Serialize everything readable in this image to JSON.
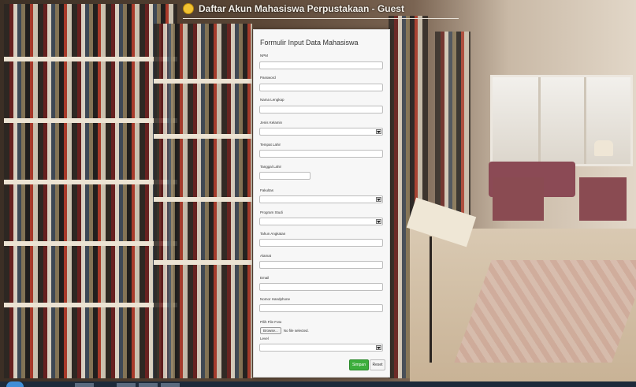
{
  "page": {
    "title": "Daftar Akun Mahasiswa Perpustakaan - Guest"
  },
  "form": {
    "title": "Formulir Input Data Mahasiswa",
    "fields": [
      {
        "label": "NPM",
        "type": "text",
        "value": ""
      },
      {
        "label": "Password",
        "type": "text",
        "value": ""
      },
      {
        "label": "Nama Lengkap",
        "type": "text",
        "value": ""
      },
      {
        "label": "Jenis Kelamin",
        "type": "select",
        "value": ""
      },
      {
        "label": "Tempat Lahir",
        "type": "text",
        "value": ""
      },
      {
        "label": "Tanggal Lahir",
        "type": "text",
        "value": ""
      },
      {
        "label": "Fakultas",
        "type": "select",
        "value": ""
      },
      {
        "label": "Program Studi",
        "type": "select",
        "value": ""
      },
      {
        "label": "Tahun Angkatan",
        "type": "text",
        "value": ""
      },
      {
        "label": "Alamat",
        "type": "text",
        "value": ""
      },
      {
        "label": "Email",
        "type": "text",
        "value": ""
      },
      {
        "label": "Nomor Handphone",
        "type": "text",
        "value": ""
      },
      {
        "label": "Pilih File Foto",
        "type": "file",
        "value": ""
      },
      {
        "label": "Level",
        "type": "select",
        "value": ""
      }
    ],
    "file": {
      "button_label": "Browse...",
      "status": "No file selected."
    },
    "buttons": {
      "save": "Simpan",
      "reset": "Reset"
    }
  },
  "icons": {
    "title_icon": "user-icon",
    "select_arrow": "chevron-down-icon"
  },
  "colors": {
    "save_button": "#3cae3c",
    "panel_bg": "#f7f7f7"
  }
}
